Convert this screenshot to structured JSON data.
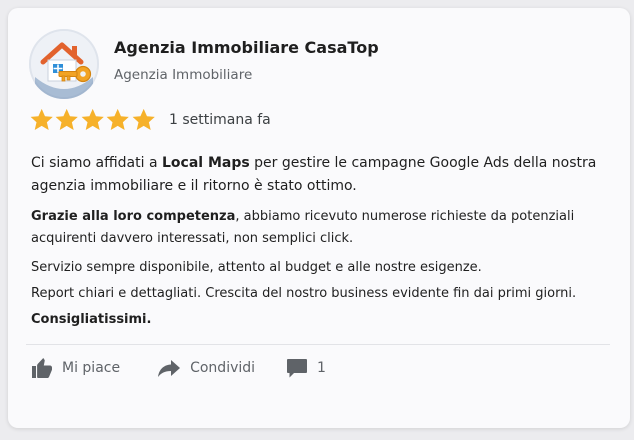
{
  "business": {
    "name": "Agenzia Immobiliare CasaTop",
    "category": "Agenzia Immobiliare",
    "avatar_icon": "house-key-icon"
  },
  "rating": {
    "stars": 5,
    "max": 5,
    "star_color": "#f6b12a",
    "time_ago": "1 settimana fa"
  },
  "review": {
    "p1": {
      "a": "Ci siamo affidati a ",
      "b_bold": "Local Maps",
      "c": " per gestire le campagne Google Ads della nostra agenzia immobiliare e il ritorno è stato ottimo."
    },
    "p2": {
      "a_bold": "Grazie alla loro competenza",
      "b": ", abbiamo ricevuto numerose richieste da potenziali acquirenti davvero interessati, non semplici click."
    },
    "p3": "Servizio sempre disponibile, attento al budget e alle nostre esigenze.",
    "p4": "Report chiari e dettagliati. Crescita del nostro business evidente fin dai primi giorni.",
    "p5_bold": "Consigliatissimi."
  },
  "actions": {
    "like": {
      "label": "Mi piace",
      "icon": "thumbs-up-icon"
    },
    "share": {
      "label": "Condividi",
      "icon": "share-arrow-icon"
    },
    "comment": {
      "count": "1",
      "icon": "comment-icon"
    }
  },
  "colors": {
    "icon_gray": "#5f6368",
    "star": "#f6b12a"
  }
}
